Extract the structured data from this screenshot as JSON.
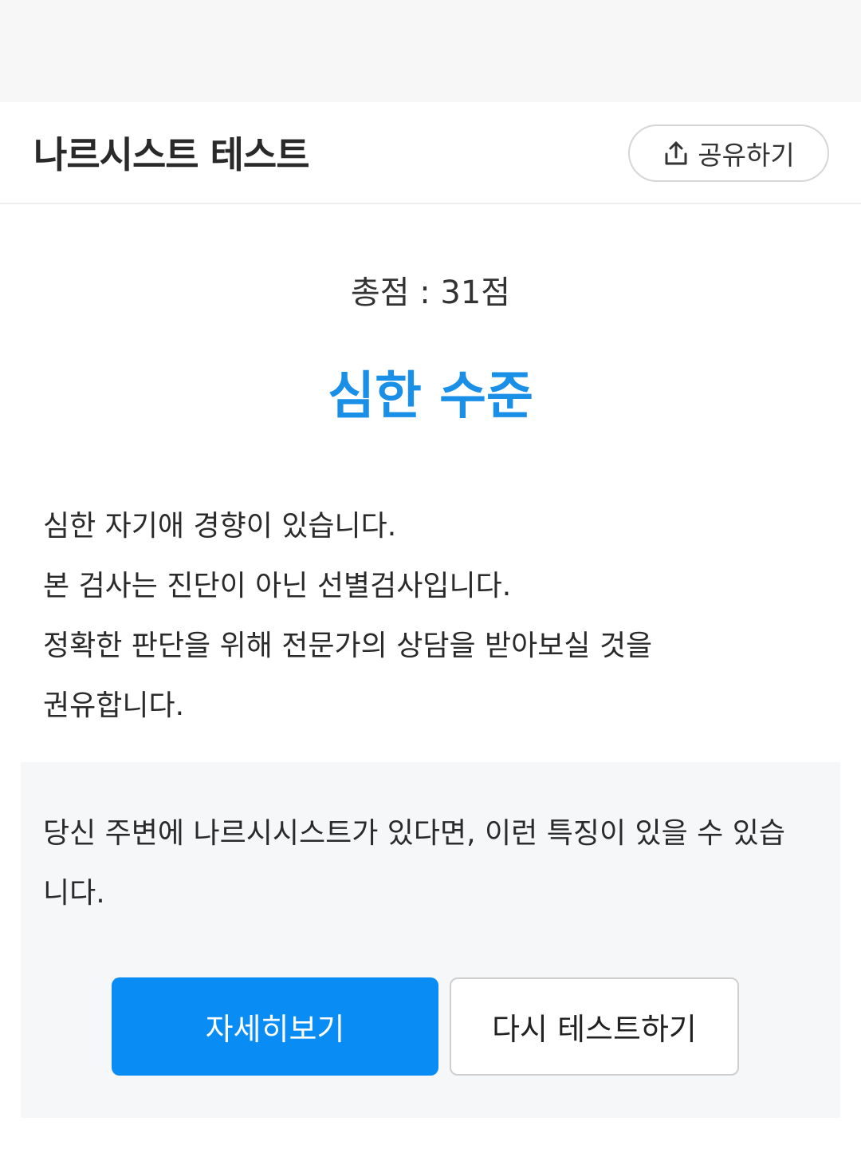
{
  "header": {
    "title": "나르시스트 테스트",
    "share_label": "공유하기",
    "share_icon": "share-upload-icon"
  },
  "result": {
    "score_text": "총점 : 31점",
    "level": "심한 수준",
    "level_color": "#1a8fe8",
    "description": [
      "심한 자기애 경향이 있습니다.",
      "본 검사는 진단이 아닌 선별검사입니다.",
      "정확한 판단을 위해 전문가의 상담을 받아보실 것을",
      "권유합니다."
    ]
  },
  "info": {
    "text": "당신 주변에 나르시시스트가 있다면, 이런 특징이 있을 수 있습니다."
  },
  "actions": {
    "detail_label": "자세히보기",
    "retry_label": "다시 테스트하기",
    "primary_color": "#0a8cf5"
  }
}
